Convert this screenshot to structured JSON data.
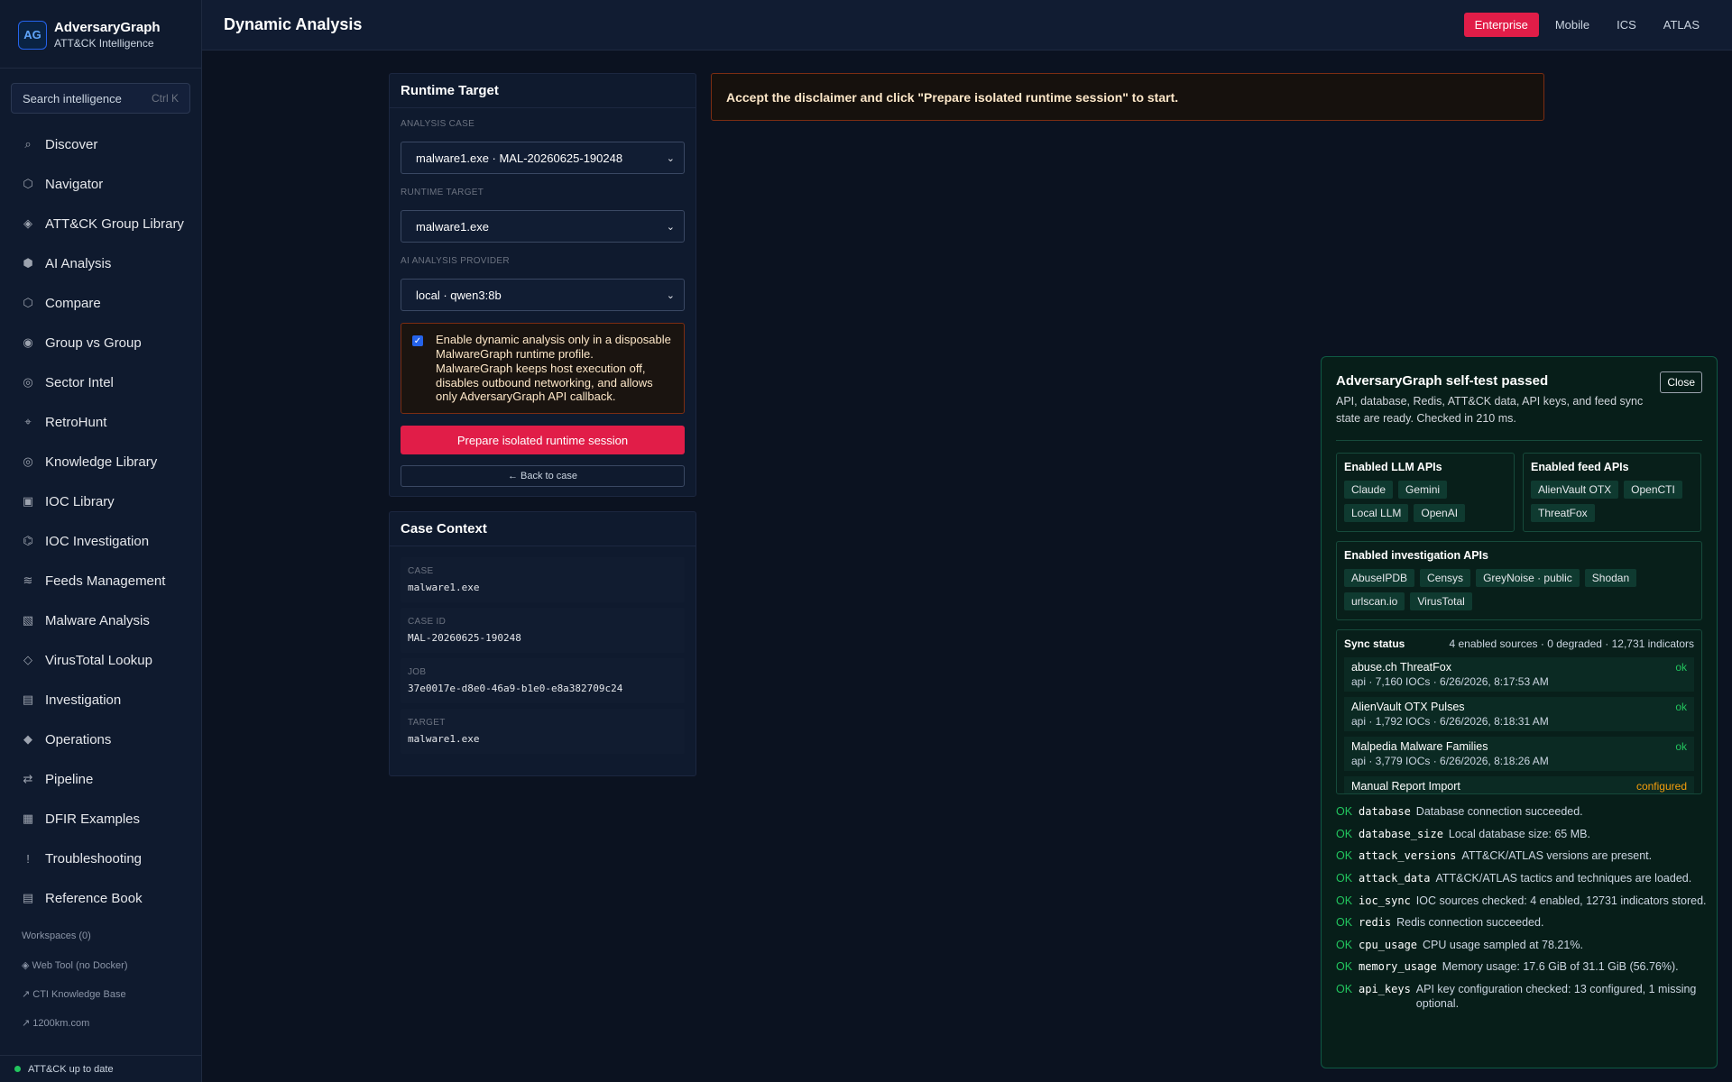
{
  "app": {
    "name": "AdversaryGraph",
    "subtitle": "ATT&CK Intelligence",
    "logo_text": "AG"
  },
  "search": {
    "placeholder": "Search intelligence",
    "shortcut": "Ctrl K"
  },
  "nav": [
    {
      "label": "Discover",
      "icon": "⌕",
      "name": "discover"
    },
    {
      "label": "Navigator",
      "icon": "⬡",
      "name": "navigator"
    },
    {
      "label": "ATT&CK Group Library",
      "icon": "◈",
      "name": "group-library"
    },
    {
      "label": "AI Analysis",
      "icon": "⬢",
      "name": "ai-analysis"
    },
    {
      "label": "Compare",
      "icon": "⬡",
      "name": "compare"
    },
    {
      "label": "Group vs Group",
      "icon": "◉",
      "name": "group-vs-group"
    },
    {
      "label": "Sector Intel",
      "icon": "◎",
      "name": "sector-intel"
    },
    {
      "label": "RetroHunt",
      "icon": "⌖",
      "name": "retrohunt"
    },
    {
      "label": "Knowledge Library",
      "icon": "◎",
      "name": "knowledge-library"
    },
    {
      "label": "IOC Library",
      "icon": "▣",
      "name": "ioc-library"
    },
    {
      "label": "IOC Investigation",
      "icon": "⌬",
      "name": "ioc-investigation"
    },
    {
      "label": "Feeds Management",
      "icon": "≋",
      "name": "feeds-management"
    },
    {
      "label": "Malware Analysis",
      "icon": "▧",
      "name": "malware-analysis"
    },
    {
      "label": "VirusTotal Lookup",
      "icon": "◇",
      "name": "virustotal-lookup"
    },
    {
      "label": "Investigation",
      "icon": "▤",
      "name": "investigation"
    },
    {
      "label": "Operations",
      "icon": "◆",
      "name": "operations"
    },
    {
      "label": "Pipeline",
      "icon": "⇄",
      "name": "pipeline"
    },
    {
      "label": "DFIR Examples",
      "icon": "▦",
      "name": "dfir-examples"
    },
    {
      "label": "Troubleshooting",
      "icon": "!",
      "name": "troubleshooting"
    },
    {
      "label": "Reference Book",
      "icon": "▤",
      "name": "reference-book"
    }
  ],
  "side_links": {
    "workspaces": "Workspaces (0)",
    "web_tool": "◈ Web Tool (no Docker)",
    "cti_kb": "↗ CTI Knowledge Base",
    "site": "↗ 1200km.com"
  },
  "footer_status": "ATT&CK up to date",
  "header": {
    "title": "Dynamic Analysis",
    "matrix_tabs": [
      "Enterprise",
      "Mobile",
      "ICS",
      "ATLAS"
    ],
    "active_tab": "Enterprise"
  },
  "runtime": {
    "title": "Runtime Target",
    "case_label": "Analysis case",
    "case_value": "malware1.exe · MAL-20260625-190248",
    "target_label": "Runtime target",
    "target_value": "malware1.exe",
    "provider_label": "AI analysis provider",
    "provider_value": "local · qwen3:8b",
    "disclaimer": "Enable dynamic analysis only in a disposable MalwareGraph runtime profile. MalwareGraph keeps host execution off, disables outbound networking, and allows only AdversaryGraph API callback.",
    "disclaimer_checked": true,
    "prepare_button": "Prepare isolated runtime session",
    "back_button": "← Back to case"
  },
  "context": {
    "title": "Case Context",
    "fields": [
      {
        "label": "Case",
        "value": "malware1.exe"
      },
      {
        "label": "Case ID",
        "value": "MAL-20260625-190248"
      },
      {
        "label": "Job",
        "value": "37e0017e-d8e0-46a9-b1e0-e8a382709c24"
      },
      {
        "label": "Target",
        "value": "malware1.exe"
      }
    ]
  },
  "alert": "Accept the disclaimer and click \"Prepare isolated runtime session\" to start.",
  "selftest": {
    "title": "AdversaryGraph self-test passed",
    "description": "API, database, Redis, ATT&CK data, API keys, and feed sync state are ready. Checked in 210 ms.",
    "close": "Close",
    "llm_title": "Enabled LLM APIs",
    "llm": [
      "Claude",
      "Gemini",
      "Local LLM",
      "OpenAI"
    ],
    "feed_title": "Enabled feed APIs",
    "feeds": [
      "AlienVault OTX",
      "OpenCTI",
      "ThreatFox"
    ],
    "inv_title": "Enabled investigation APIs",
    "investigation": [
      "AbuseIPDB",
      "Censys",
      "GreyNoise · public",
      "Shodan",
      "urlscan.io",
      "VirusTotal"
    ],
    "sync_title": "Sync status",
    "sync_summary": "4 enabled sources · 0 degraded · 12,731 indicators",
    "sync_rows": [
      {
        "name": "abuse.ch ThreatFox",
        "status": "ok",
        "detail": "api · 7,160 IOCs · 6/26/2026, 8:17:53 AM"
      },
      {
        "name": "AlienVault OTX Pulses",
        "status": "ok",
        "detail": "api · 1,792 IOCs · 6/26/2026, 8:18:31 AM"
      },
      {
        "name": "Malpedia Malware Families",
        "status": "ok",
        "detail": "api · 3,779 IOCs · 6/26/2026, 8:18:26 AM"
      },
      {
        "name": "Manual Report Import",
        "status": "configured",
        "detail": ""
      }
    ],
    "checks": [
      {
        "status": "OK",
        "key": "database",
        "msg": "Database connection succeeded."
      },
      {
        "status": "OK",
        "key": "database_size",
        "msg": "Local database size: 65 MB."
      },
      {
        "status": "OK",
        "key": "attack_versions",
        "msg": "ATT&CK/ATLAS versions are present."
      },
      {
        "status": "OK",
        "key": "attack_data",
        "msg": "ATT&CK/ATLAS tactics and techniques are loaded."
      },
      {
        "status": "OK",
        "key": "ioc_sync",
        "msg": "IOC sources checked: 4 enabled, 12731 indicators stored."
      },
      {
        "status": "OK",
        "key": "redis",
        "msg": "Redis connection succeeded."
      },
      {
        "status": "OK",
        "key": "cpu_usage",
        "msg": "CPU usage sampled at 78.21%."
      },
      {
        "status": "OK",
        "key": "memory_usage",
        "msg": "Memory usage: 17.6 GiB of 31.1 GiB (56.76%)."
      },
      {
        "status": "OK",
        "key": "api_keys",
        "msg": "API key configuration checked: 13 configured, 1 missing optional."
      }
    ]
  }
}
